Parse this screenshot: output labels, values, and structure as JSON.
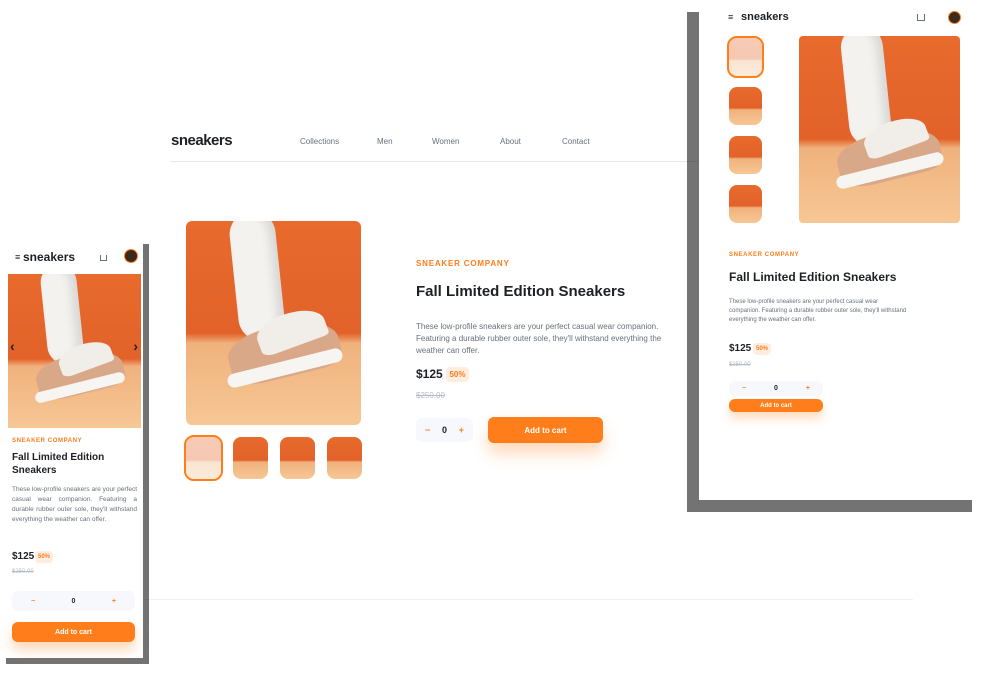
{
  "brand": "sneakers",
  "nav": [
    "Collections",
    "Men",
    "Women",
    "About",
    "Contact"
  ],
  "product": {
    "company": "SNEAKER COMPANY",
    "title": "Fall Limited Edition Sneakers",
    "description": "These low-profile sneakers are your perfect casual wear companion. Featuring a durable rubber outer sole, they'll withstand everything the weather can offer.",
    "price": "$125",
    "discount": "50%",
    "old_price": "$250.00",
    "quantity": "0",
    "minus": "−",
    "plus": "+",
    "add_to_cart": "Add to cart"
  },
  "mobile": {
    "prev": "‹",
    "next": "›",
    "menu": "≡"
  },
  "icons": {
    "cart": "cart-icon",
    "menu": "menu-icon",
    "avatar": "avatar-icon"
  },
  "colors": {
    "accent": "#ff7d1a",
    "pale": "#ffede0",
    "dark": "#1d2025",
    "grey": "#69707d"
  }
}
